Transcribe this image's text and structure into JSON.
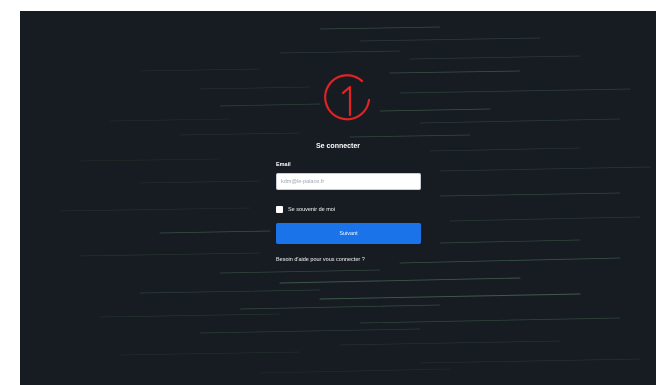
{
  "brand": {
    "logo_icon": "circled-one-logo",
    "logo_color": "#e02323"
  },
  "colors": {
    "background": "#161c22",
    "accent": "#1a73e8",
    "text": "#ffffff"
  },
  "login": {
    "title": "Se connecter",
    "email_label": "Email",
    "email_placeholder": "kdm@le-palace.fr",
    "email_value": "",
    "remember_label": "Se souvenir de moi",
    "remember_checked": false,
    "submit_label": "Suivant",
    "help_link": "Besoin d'aide pour vous connecter ?"
  }
}
